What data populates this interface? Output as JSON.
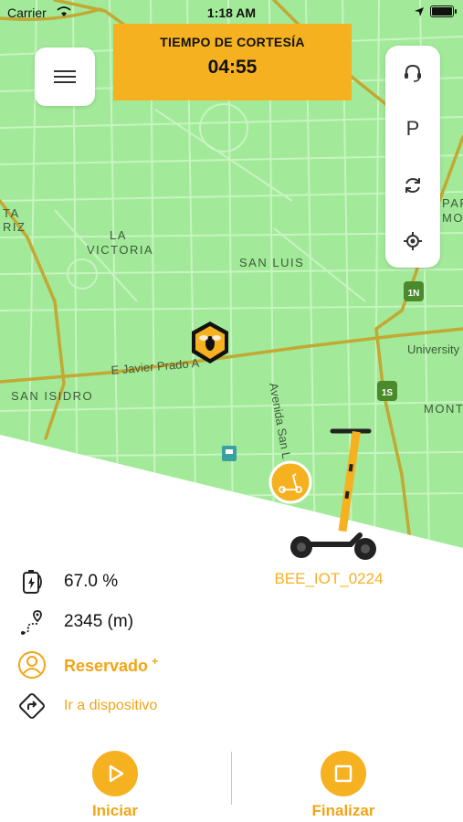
{
  "status": {
    "carrier": "Carrier",
    "time": "1:18 AM"
  },
  "courtesy": {
    "label": "TIEMPO DE CORTESÍA",
    "timer": "04:55"
  },
  "map": {
    "labels": {
      "la": "LA",
      "victoria": "VICTORIA",
      "san_luis": "SAN LUIS",
      "san_isidro": "SAN ISIDRO",
      "javier_prado": "E Javier Prado A",
      "avenida_san": "Avenida San L",
      "university": "University",
      "mont": "MONT",
      "par": "PAR",
      "mon": "MON",
      "riz": "RIZ",
      "ta": "TA",
      "route_1n": "1N",
      "route_1s": "1S"
    },
    "colors": {
      "land": "#a2ea99",
      "road_major": "#c3a832",
      "road_minor": "#c8f4c2"
    }
  },
  "panel": {
    "items": [
      "headset-icon",
      "parking-icon",
      "refresh-icon",
      "locate-icon"
    ],
    "parking_label": "P"
  },
  "scooter": {
    "id": "BEE_IOT_0224"
  },
  "info": {
    "battery": "67.0 %",
    "distance": "2345 (m)",
    "reserved": "Reservado",
    "reserved_mark": "+",
    "go_to_device": "Ir a dispositivo"
  },
  "actions": {
    "start": "Iniciar",
    "finish": "Finalizar"
  },
  "colors": {
    "accent": "#f6b121",
    "accent_text": "#f2a516"
  }
}
